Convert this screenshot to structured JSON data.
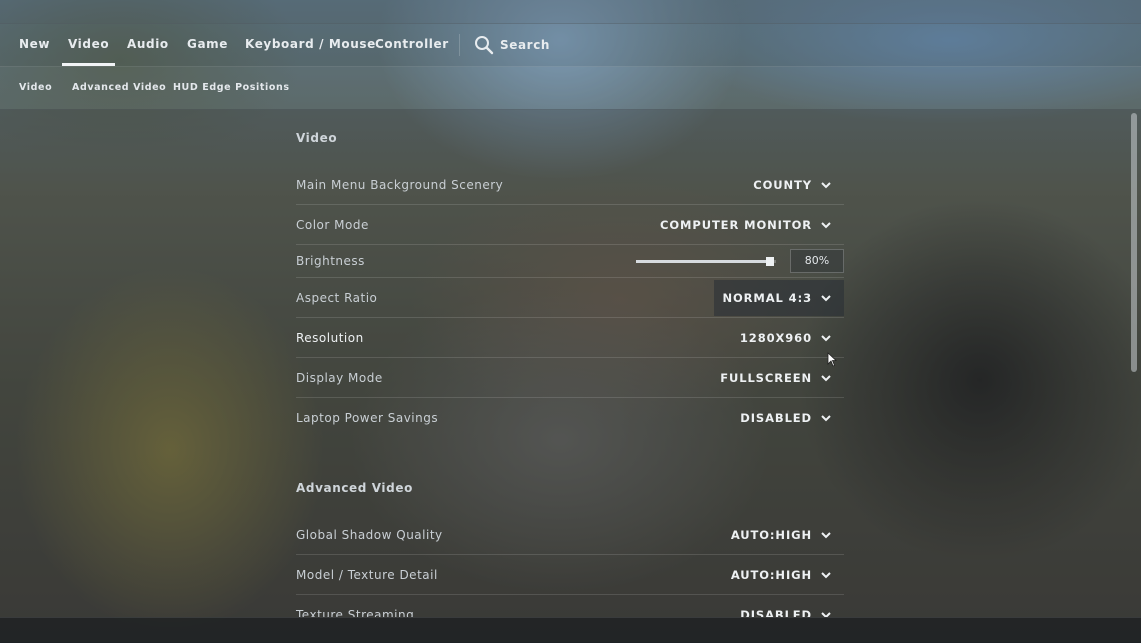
{
  "nav": {
    "tabs": [
      {
        "label": "New"
      },
      {
        "label": "Video"
      },
      {
        "label": "Audio"
      },
      {
        "label": "Game"
      },
      {
        "label": "Keyboard / Mouse"
      },
      {
        "label": "Controller"
      }
    ],
    "active_tab": "Video",
    "search_label": "Search"
  },
  "subnav": {
    "tabs": [
      {
        "label": "Video"
      },
      {
        "label": "Advanced Video"
      },
      {
        "label": "HUD Edge Positions"
      }
    ]
  },
  "video": {
    "section_title": "Video",
    "settings": [
      {
        "label": "Main Menu Background Scenery",
        "value": "COUNTY"
      },
      {
        "label": "Color Mode",
        "value": "COMPUTER MONITOR"
      },
      {
        "label": "Brightness",
        "value": "80%",
        "slider_fraction": 0.96
      },
      {
        "label": "Aspect Ratio",
        "value": "NORMAL 4:3"
      },
      {
        "label": "Resolution",
        "value": "1280X960"
      },
      {
        "label": "Display Mode",
        "value": "FULLSCREEN"
      },
      {
        "label": "Laptop Power Savings",
        "value": "DISABLED"
      }
    ]
  },
  "advanced_video": {
    "section_title": "Advanced Video",
    "settings": [
      {
        "label": "Global Shadow Quality",
        "value": "AUTO:HIGH"
      },
      {
        "label": "Model / Texture Detail",
        "value": "AUTO:HIGH"
      },
      {
        "label": "Texture Streaming",
        "value": "DISABLED"
      }
    ]
  },
  "colors": {
    "accent": "#f2f4f6",
    "text_primary": "#eef1f3",
    "text_secondary": "#c9cfd4"
  }
}
